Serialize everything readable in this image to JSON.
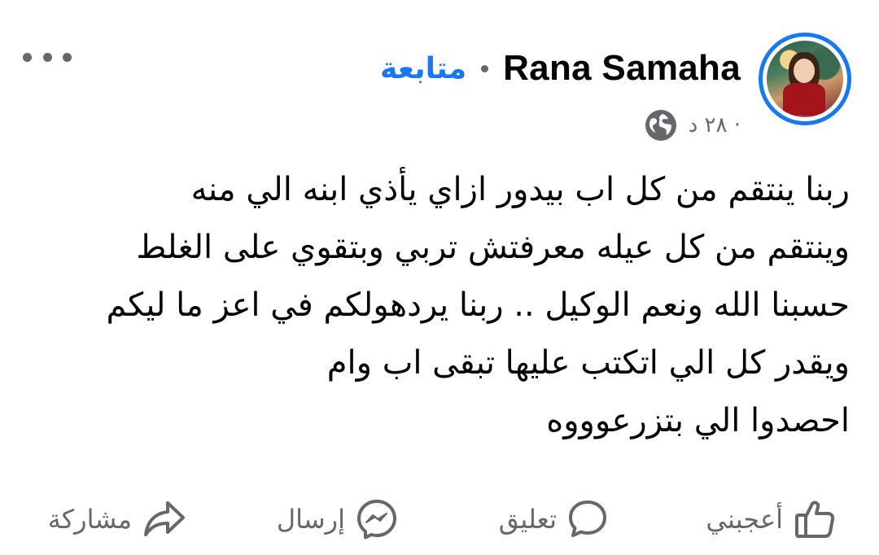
{
  "post": {
    "author": {
      "name": "Rana Samaha",
      "follow_label": "متابعة",
      "time_label": "٢٨ د ·",
      "privacy_icon": "globe-icon"
    },
    "more_icon": "more-dots-icon",
    "text_lines": [
      "ربنا ينتقم من كل اب بيدور ازاي يأذي ابنه الي منه",
      "وينتقم من كل عيله معرفتش تربي وبتقوي على الغلط",
      "حسبنا الله ونعم الوكيل  .. ربنا يردهولكم في اعز ما ليكم",
      "ويقدر كل الي اتكتب عليها تبقى اب وام",
      "احصدوا الي بتزرعوووه"
    ],
    "actions": {
      "like": {
        "label": "أعجبني",
        "icon": "thumbs-up-icon"
      },
      "comment": {
        "label": "تعليق",
        "icon": "comment-bubble-icon"
      },
      "send": {
        "label": "إرسال",
        "icon": "messenger-icon"
      },
      "share": {
        "label": "مشاركة",
        "icon": "share-arrow-icon"
      }
    }
  },
  "colors": {
    "accent": "#1877f2",
    "text": "#050505",
    "secondary_text": "#65676b"
  }
}
